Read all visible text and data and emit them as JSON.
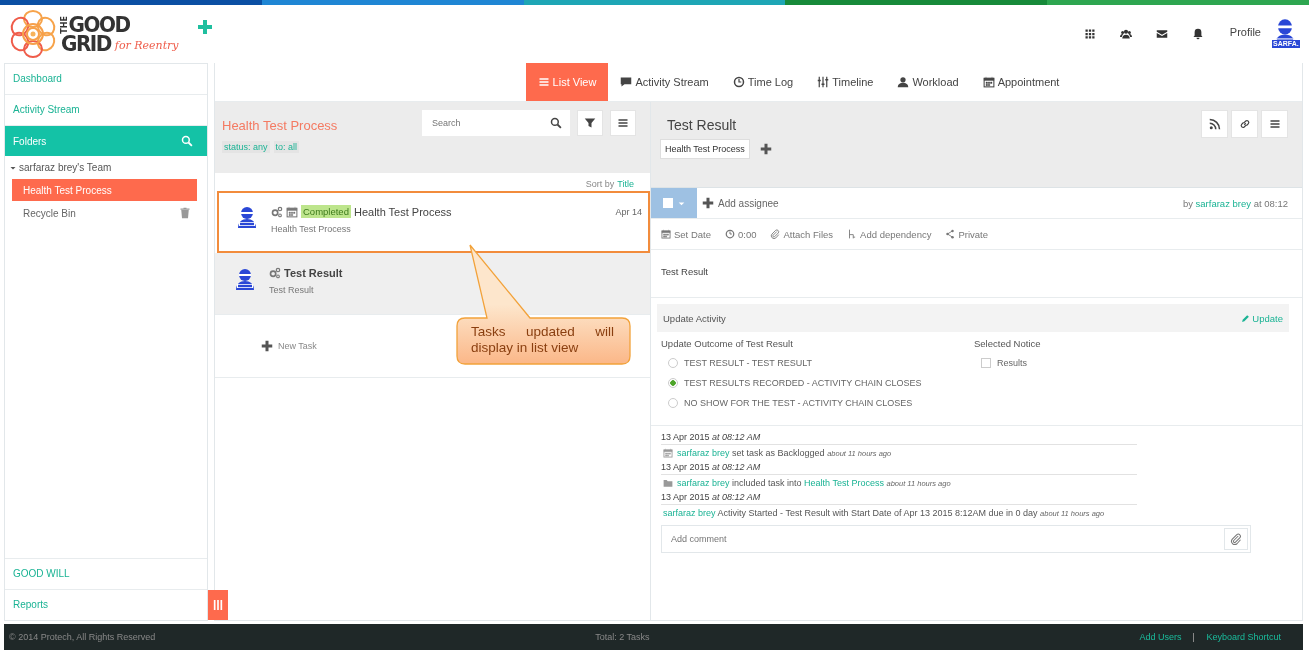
{
  "header": {
    "logo": {
      "small": "THE",
      "line_1": "GOOD",
      "line_2": "GRID",
      "tagline": "for Reentry"
    },
    "profile_label": "Profile",
    "avatar_label": "SARFA."
  },
  "sidebar": {
    "items": [
      {
        "label": "Dashboard"
      },
      {
        "label": "Activity Stream"
      }
    ],
    "folders_title": "Folders",
    "team": {
      "name": "sarfaraz brey's Team",
      "expanded": true,
      "children": [
        {
          "label": "Health Test Process",
          "selected": true,
          "kind": "folder"
        },
        {
          "label": "Recycle Bin",
          "selected": false,
          "kind": "trash"
        }
      ]
    },
    "bottom_items": [
      {
        "label": "GOOD WILL"
      },
      {
        "label": "Reports"
      }
    ]
  },
  "view_tabs": [
    {
      "label": "List View",
      "selected": true
    },
    {
      "label": "Activity Stream",
      "selected": false
    },
    {
      "label": "Time Log",
      "selected": false
    },
    {
      "label": "Timeline",
      "selected": false
    },
    {
      "label": "Workload",
      "selected": false
    },
    {
      "label": "Appointment",
      "selected": false
    }
  ],
  "task_list": {
    "title": "Health Test Process",
    "filters": [
      "status: any",
      "to: all"
    ],
    "search": {
      "placeholder": "Search"
    },
    "sort_label": "Sort by",
    "sort_value": "Title",
    "tasks": [
      {
        "title": "Health Test Process",
        "subtitle": "Health Test Process",
        "status": "Completed",
        "scheduled": true,
        "date": "Apr 14",
        "selected": false,
        "highlighted": true
      },
      {
        "title": "Test Result",
        "subtitle": "Test Result",
        "scheduled": false,
        "selected": true,
        "highlighted": false
      }
    ],
    "new_task": "New Task"
  },
  "detail": {
    "title": "Test Result",
    "tags": [
      "Health Test Process"
    ],
    "done": false,
    "add_assignee": "Add assignee",
    "author": [
      {
        "kind": "text",
        "text": "by"
      },
      {
        "kind": "link",
        "text": "sarfaraz brey"
      },
      {
        "kind": "text",
        "text": "at 08:12"
      }
    ],
    "actions": [
      "Set Date",
      "0:00",
      "Attach Files",
      "Add dependency",
      "Private"
    ],
    "description": "Test Result",
    "update": {
      "title": "Update Activity",
      "action": "Update",
      "outcome_label": "Update Outcome of Test Result",
      "options": [
        {
          "label": "TEST RESULT - TEST RESULT",
          "selected": false
        },
        {
          "label": "TEST RESULTS RECORDED - ACTIVITY CHAIN CLOSES",
          "selected": true
        },
        {
          "label": "NO SHOW FOR THE TEST - ACTIVITY CHAIN CLOSES",
          "selected": false
        }
      ],
      "notice_label": "Selected Notice",
      "notices": [
        {
          "label": "Results",
          "checked": false
        }
      ]
    },
    "log": [
      {
        "date": "13 Apr 2015 *at 08:12 AM*",
        "kind": "schedule",
        "parts": [
          {
            "kind": "link",
            "text": "sarfaraz brey"
          },
          {
            "kind": "text",
            "text": "set task as Backlogged"
          },
          {
            "kind": "ago",
            "text": "about 11 hours ago"
          }
        ]
      },
      {
        "date": "13 Apr 2015 *at 08:12 AM*",
        "kind": "folder",
        "parts": [
          {
            "kind": "link",
            "text": "sarfaraz brey"
          },
          {
            "kind": "text",
            "text": "included task into"
          },
          {
            "kind": "link",
            "text": "Health Test Process"
          },
          {
            "kind": "ago",
            "text": "about 11 hours ago"
          }
        ]
      },
      {
        "date": "13 Apr 2015 *at 08:12 AM*",
        "kind": "start",
        "parts": [
          {
            "kind": "link",
            "text": "sarfaraz brey"
          },
          {
            "kind": "text",
            "text": "Activity Started - Test Result with Start Date of Apr 13 2015 8:12AM due in 0 day"
          },
          {
            "kind": "ago",
            "text": "about 11 hours ago"
          }
        ]
      }
    ],
    "comment": {
      "placeholder": "Add comment"
    }
  },
  "footer": {
    "copyright": "© 2014 Protech, All Rights Reserved",
    "total": "Total: 2 Tasks",
    "links": [
      "Add Users",
      "Keyboard Shortcut"
    ]
  },
  "annotation": {
    "text": "Tasks updated will display in list view"
  }
}
